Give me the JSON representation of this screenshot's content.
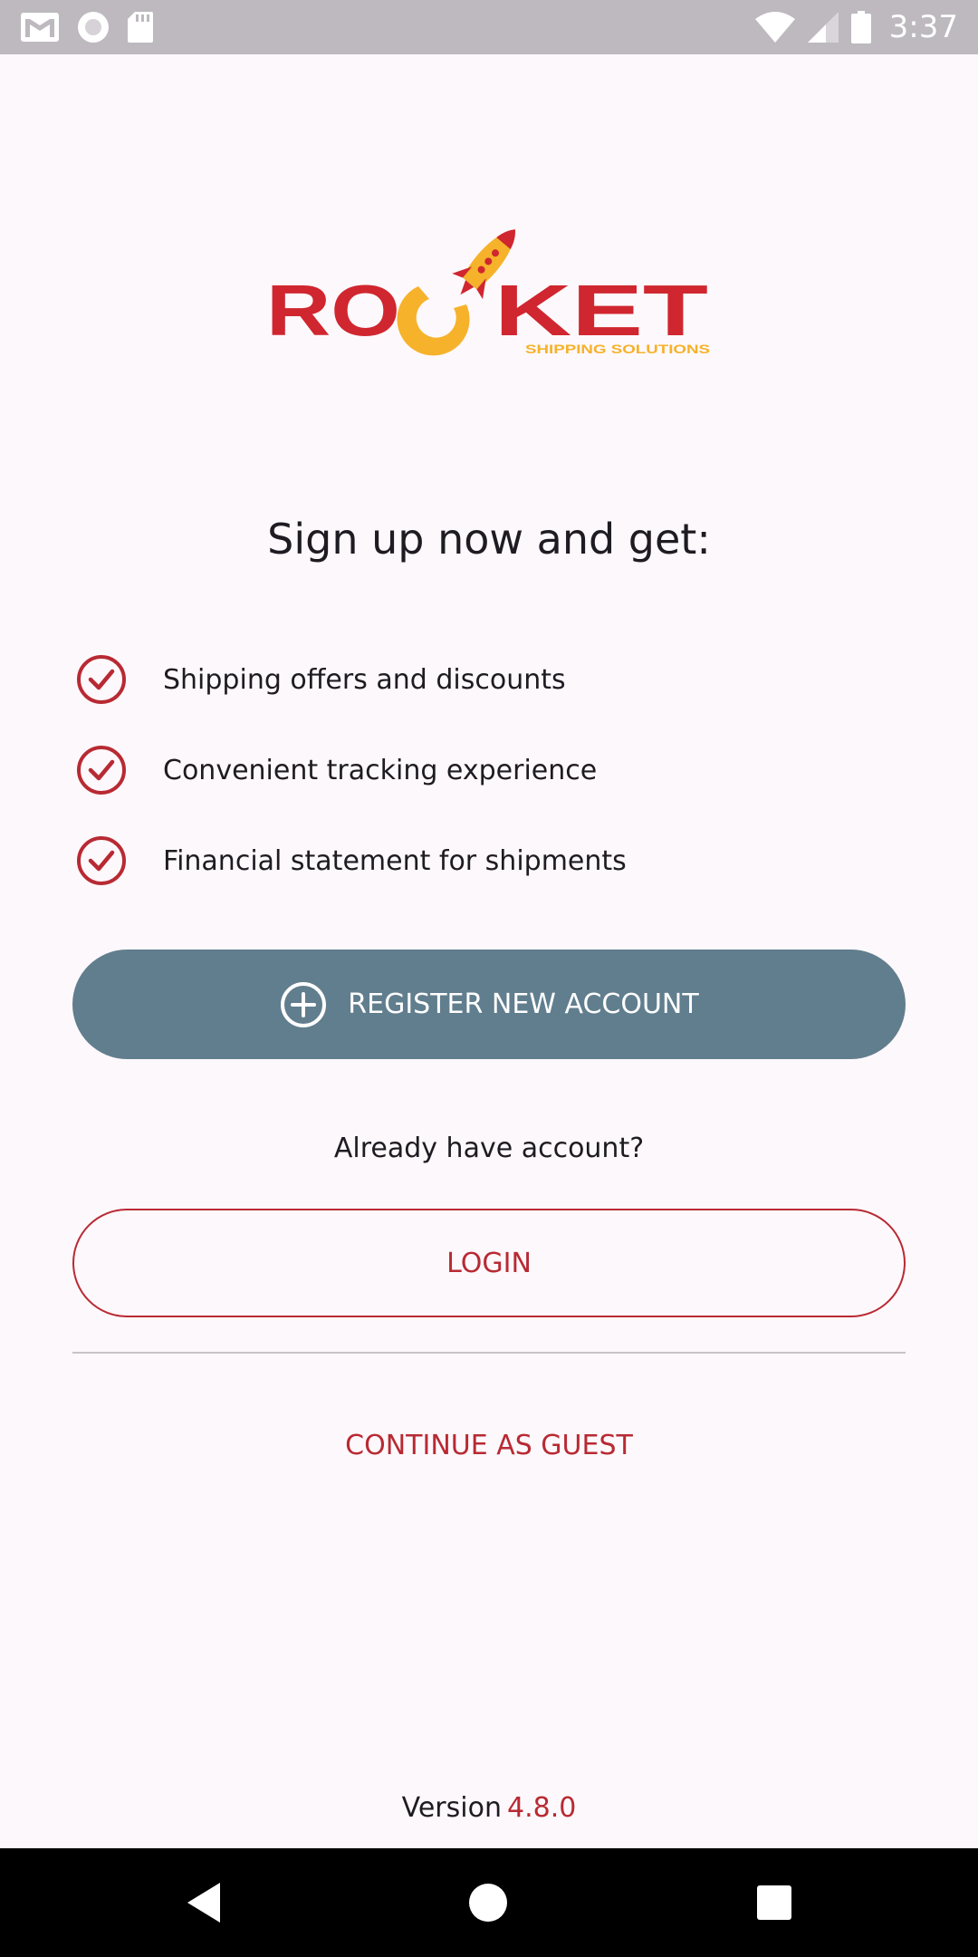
{
  "status_bar": {
    "time": "3:37",
    "icons": [
      "gmail-icon",
      "circle-notification-icon",
      "sd-card-icon",
      "wifi-icon",
      "signal-icon",
      "battery-icon"
    ]
  },
  "logo": {
    "brand_text": "ROCKET",
    "tagline": "SHIPPING SOLUTIONS",
    "colors": {
      "red": "#d0262f",
      "yellow": "#f6b22a"
    }
  },
  "headline": "Sign up now and get:",
  "benefits": [
    {
      "text": "Shipping offers and discounts",
      "icon": "check-circle-icon"
    },
    {
      "text": "Convenient tracking experience",
      "icon": "check-circle-icon"
    },
    {
      "text": "Financial statement for shipments",
      "icon": "check-circle-icon"
    }
  ],
  "register_button": {
    "label": "REGISTER NEW ACCOUNT",
    "icon": "plus-circle-icon"
  },
  "already_text": "Already have account?",
  "login_button": {
    "label": "LOGIN"
  },
  "guest_link": {
    "label": "CONTINUE AS GUEST"
  },
  "version": {
    "label": "Version",
    "number": "4.8.0"
  },
  "nav_bar": {
    "icons": [
      "back-icon",
      "home-icon",
      "recents-icon"
    ]
  },
  "colors": {
    "accent_red": "#b82a33",
    "primary_button": "#617e8e",
    "background": "#fdf8fc",
    "status_bar": "#bdb9bf"
  }
}
